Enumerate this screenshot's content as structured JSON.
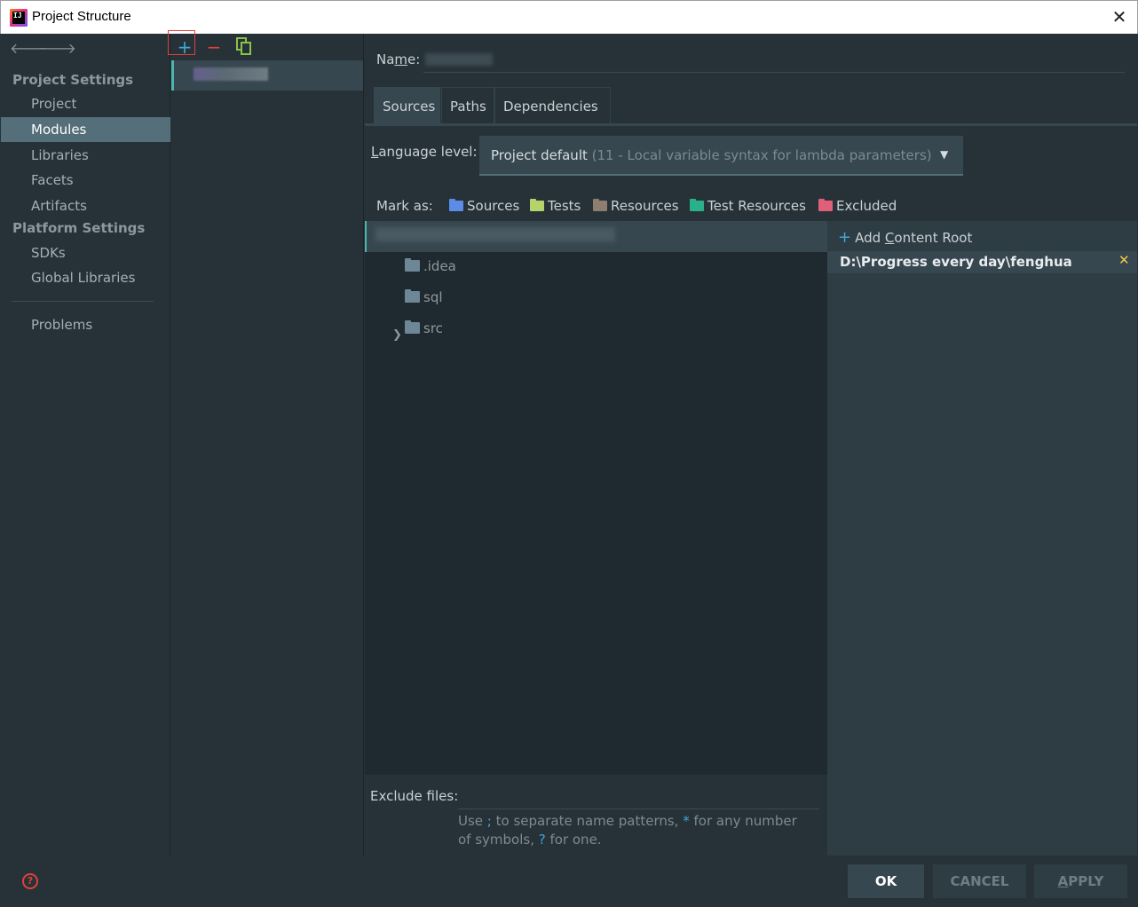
{
  "window": {
    "title": "Project Structure",
    "close_glyph": "✕"
  },
  "nav": {
    "back_glyph": "🡐",
    "forward_glyph": "🡒"
  },
  "sidebar": {
    "project_settings_header": "Project Settings",
    "project_items": [
      "Project",
      "Modules",
      "Libraries",
      "Facets",
      "Artifacts"
    ],
    "selected": "Modules",
    "platform_settings_header": "Platform Settings",
    "platform_items": [
      "SDKs",
      "Global Libraries"
    ],
    "problems": "Problems"
  },
  "modules_toolbar": {
    "add_glyph": "+",
    "remove_glyph": "−"
  },
  "module_editor": {
    "name_label": "Name:",
    "tabs": [
      "Sources",
      "Paths",
      "Dependencies"
    ],
    "active_tab": "Sources",
    "language_level_label": "Language level:",
    "language_level_value": "Project default",
    "language_level_detail": "(11 - Local variable syntax for lambda parameters)",
    "mark_as_label": "Mark as:",
    "mark_as": [
      {
        "label": "Sources",
        "color": "#5c8de6"
      },
      {
        "label": "Tests",
        "color": "#b5d36b"
      },
      {
        "label": "Resources",
        "color": "#8d7e6f"
      },
      {
        "label": "Test Resources",
        "color": "#2bb08c"
      },
      {
        "label": "Excluded",
        "color": "#e0607a"
      }
    ],
    "tree": [
      ".idea",
      "sql",
      "src"
    ],
    "add_content_root": "Add Content Root",
    "content_root_path": "D:\\Progress every day\\fenghua",
    "remove_root_glyph": "✕",
    "exclude_files_label": "Exclude files:",
    "exclude_hint": {
      "p1": "Use ",
      "semicolon": ";",
      "p2": " to separate name patterns, ",
      "star": "*",
      "p3": " for any number of symbols, ",
      "question": "?",
      "p4": " for one."
    }
  },
  "footer": {
    "help_glyph": "?",
    "ok": "OK",
    "cancel": "CANCEL",
    "apply": "APPLY"
  }
}
